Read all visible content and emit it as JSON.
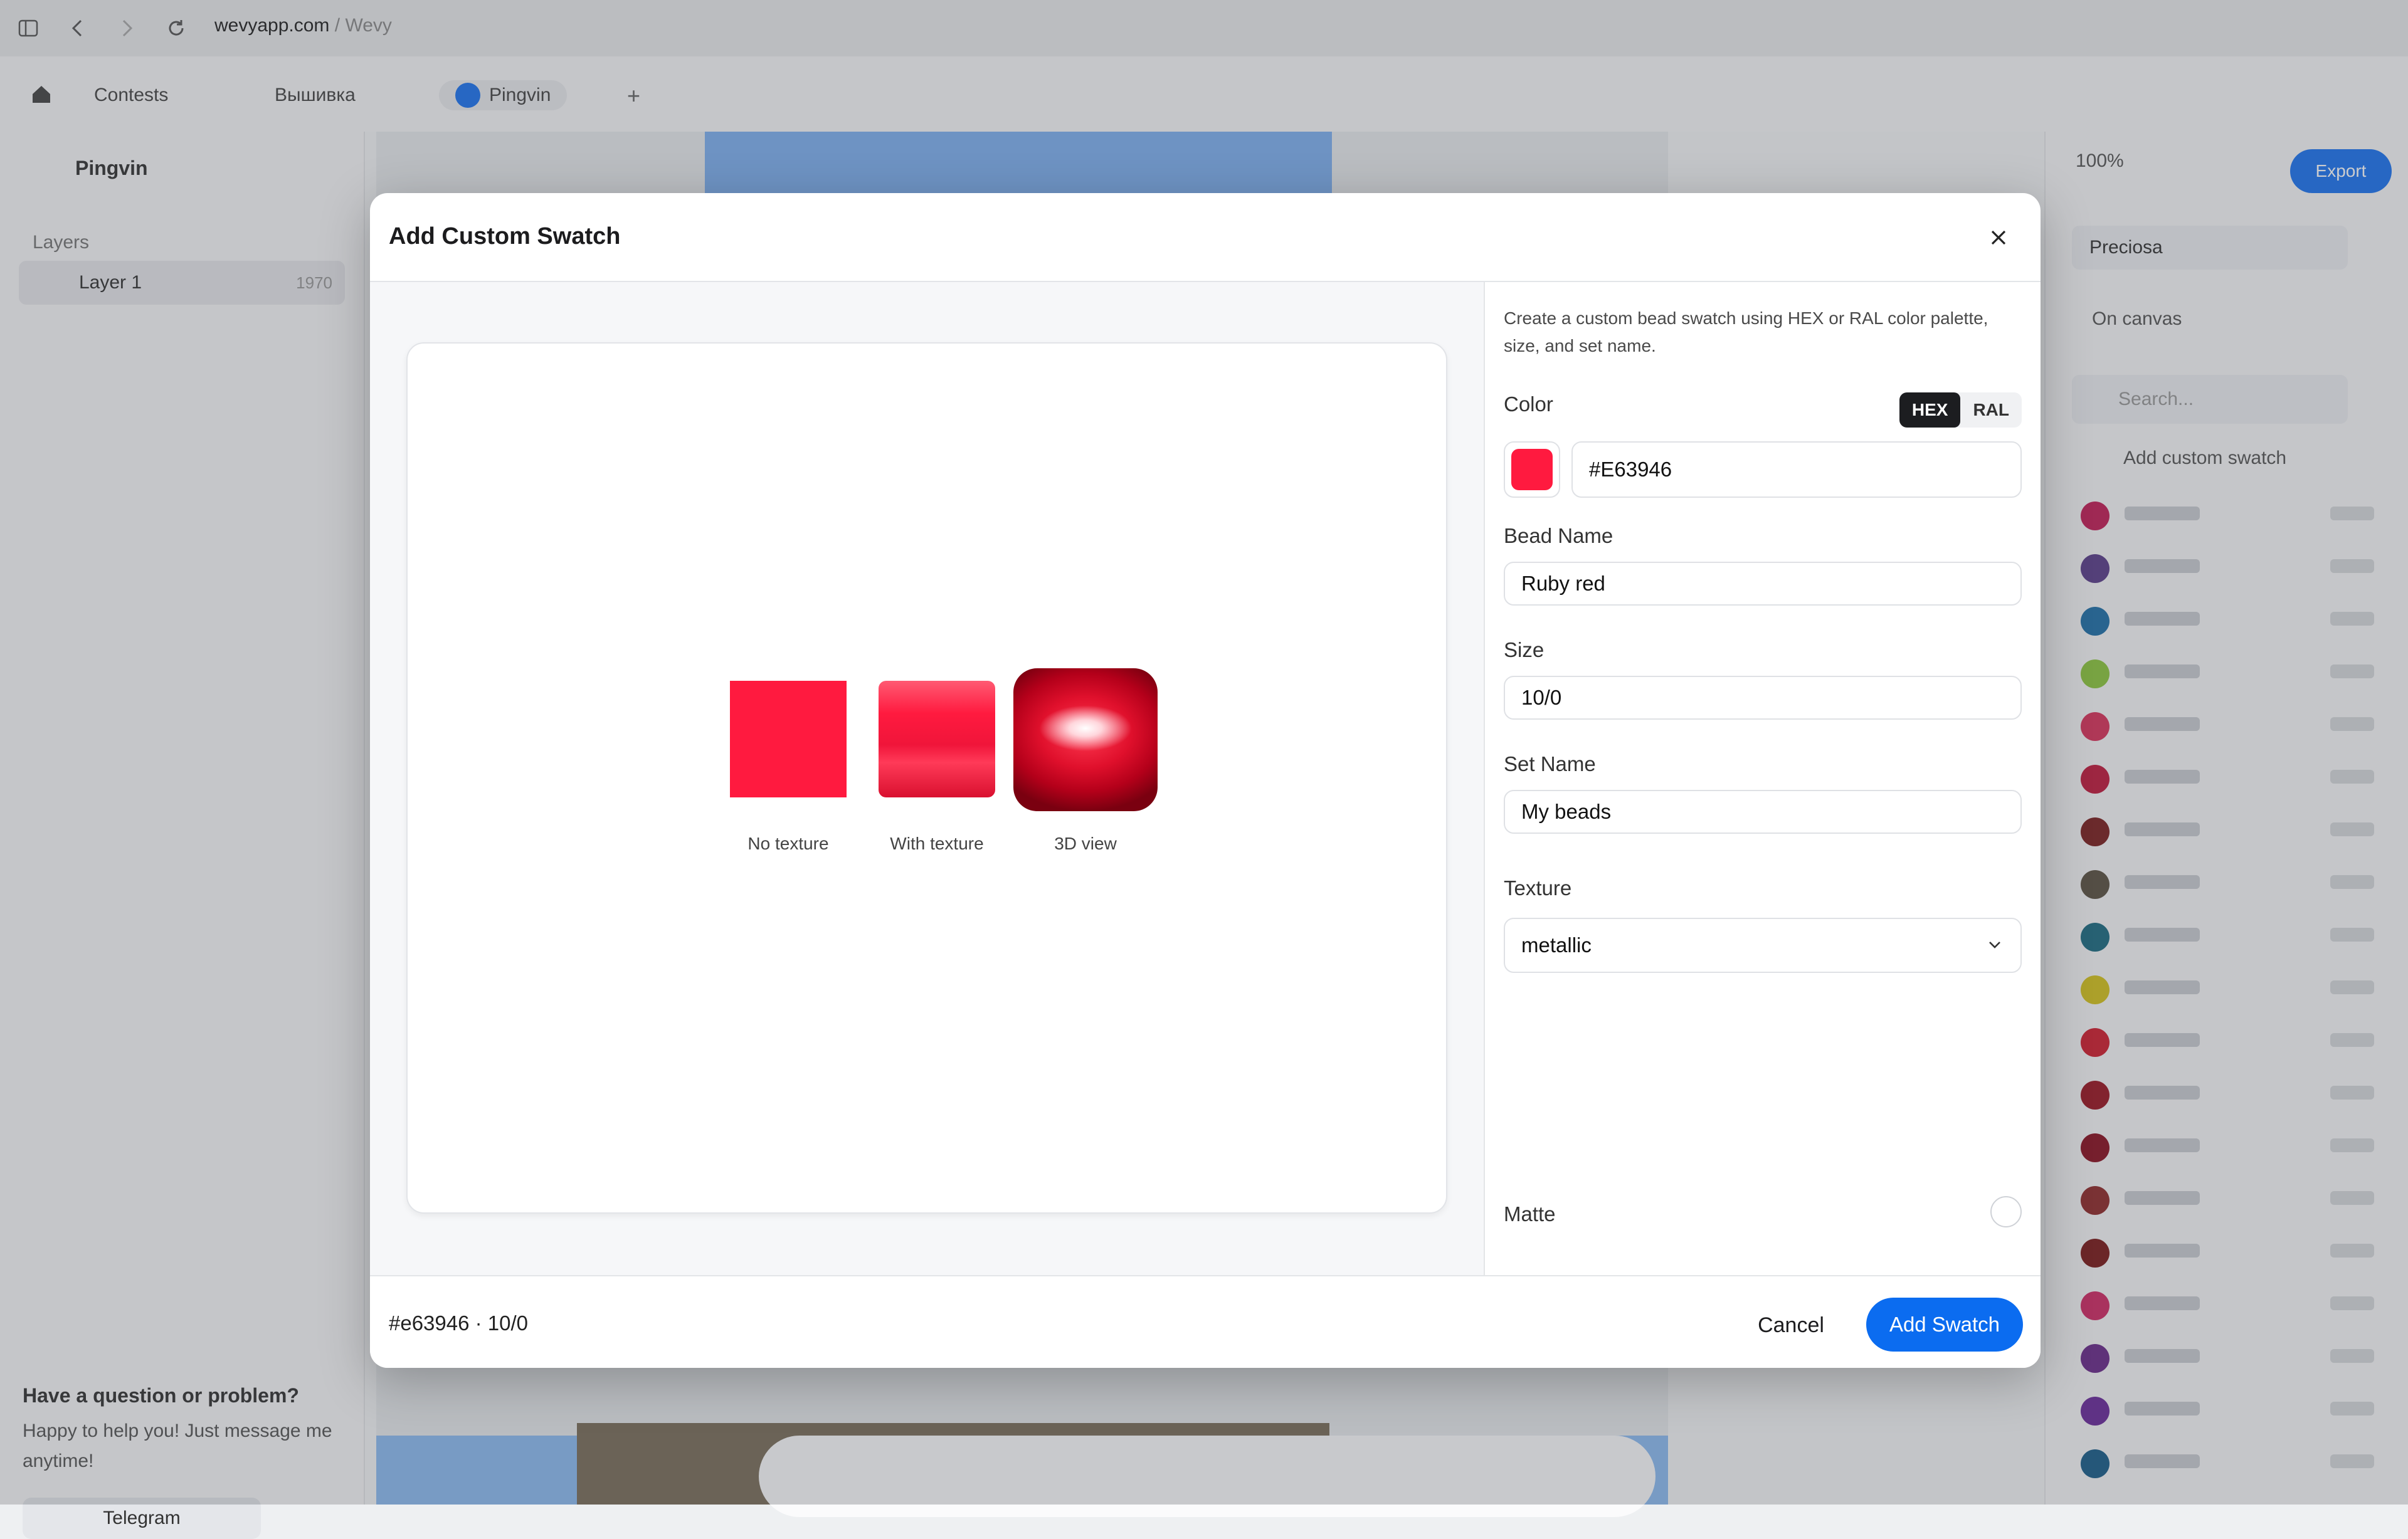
{
  "browser": {
    "url_domain": "wevyapp.com",
    "url_separator": " / ",
    "url_page": "Wevy",
    "icons": [
      "sidebar-toggle-icon",
      "back-arrow-icon",
      "forward-arrow-icon",
      "reload-icon"
    ]
  },
  "app": {
    "tabs": [
      {
        "label": "Contests"
      },
      {
        "label": "Вышивка"
      },
      {
        "label": "Pingvin"
      }
    ],
    "sidebar": {
      "title": "Pingvin",
      "layers_heading": "Layers",
      "layer_name": "Layer 1",
      "layer_count": "1970"
    },
    "help": {
      "question": "Have a question or problem?",
      "subtitle": "Happy to help you! Just message me anytime!",
      "telegram_label": "Telegram"
    },
    "right_panel": {
      "zoom": "100%",
      "export_label": "Export",
      "palette_select": "Preciosa",
      "on_canvas": "On canvas",
      "search_placeholder": "Search...",
      "add_custom_swatch": "Add custom swatch",
      "swatch_colors": [
        "#c21e56",
        "#5a3d8a",
        "#1f6fa8",
        "#8cc63e",
        "#d8325a",
        "#c01a3c",
        "#7a1f1f",
        "#5b5142",
        "#1c6b82",
        "#d4c21c",
        "#d01e2e",
        "#9a1622",
        "#8a1020",
        "#8f2a2a",
        "#7a1a1a",
        "#d02a64",
        "#6a2a8a",
        "#6a2a9a",
        "#1a5d8a"
      ]
    }
  },
  "modal": {
    "title": "Add Custom Swatch",
    "close_icon": "close-icon",
    "preview": {
      "color": "#FF1A3F",
      "labels": {
        "no_texture": "No texture",
        "with_texture": "With texture",
        "view_3d": "3D view"
      }
    },
    "form": {
      "description": "Create a custom bead swatch using HEX or RAL color palette, size, and set name.",
      "color_label": "Color",
      "mode_hex": "HEX",
      "mode_ral": "RAL",
      "active_mode": "HEX",
      "hex_value": "#E63946",
      "bead_name_label": "Bead Name",
      "bead_name_value": "Ruby red",
      "size_label": "Size",
      "size_value": "10/0",
      "set_name_label": "Set Name",
      "set_name_value": "My beads",
      "texture_label": "Texture",
      "texture_value": "metallic",
      "matte_label": "Matte",
      "matte_checked": false
    },
    "footer": {
      "summary": "#e63946 · 10/0",
      "cancel_label": "Cancel",
      "add_label": "Add Swatch"
    }
  },
  "colors": {
    "accent": "#0b6cf0",
    "swatch_red": "#FF1A3F"
  }
}
